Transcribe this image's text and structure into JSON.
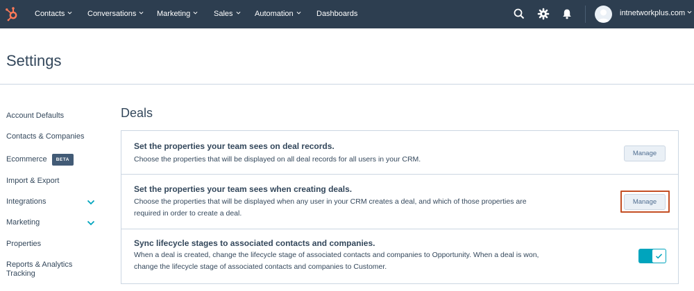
{
  "topnav": {
    "items": [
      {
        "label": "Contacts",
        "has_dropdown": true
      },
      {
        "label": "Conversations",
        "has_dropdown": true
      },
      {
        "label": "Marketing",
        "has_dropdown": true
      },
      {
        "label": "Sales",
        "has_dropdown": true
      },
      {
        "label": "Automation",
        "has_dropdown": true
      },
      {
        "label": "Dashboards",
        "has_dropdown": false
      }
    ],
    "icons": [
      "hubspot-logo-icon",
      "search-icon",
      "gear-icon",
      "bell-icon"
    ],
    "account": "intnetworkplus.com"
  },
  "page": {
    "title": "Settings"
  },
  "sidebar": {
    "items": [
      {
        "label": "Account Defaults"
      },
      {
        "label": "Contacts & Companies"
      },
      {
        "label": "Ecommerce",
        "badge": "BETA"
      },
      {
        "label": "Import & Export"
      },
      {
        "label": "Integrations",
        "expandable": true
      },
      {
        "label": "Marketing",
        "expandable": true
      },
      {
        "label": "Properties"
      },
      {
        "label": "Reports & Analytics Tracking"
      }
    ]
  },
  "main": {
    "section_title": "Deals",
    "cards": [
      {
        "title": "Set the properties your team sees on deal records.",
        "desc_lines": [
          "Choose the properties that will be displayed on all deal records for all users in your CRM."
        ],
        "action": "Manage"
      },
      {
        "title": "Set the properties your team sees when creating deals.",
        "desc_lines": [
          "Choose the properties that will be displayed when any user in your CRM creates a deal, and which of those properties are",
          "required in order to create a deal."
        ],
        "action": "Manage",
        "highlighted": true
      },
      {
        "title": "Sync lifecycle stages to associated contacts and companies.",
        "desc_lines": [
          "When a deal is created, change the lifecycle stage of associated contacts and companies to Opportunity. When a deal is won,",
          "change the lifecycle stage of associated contacts and companies to Customer."
        ],
        "toggle_on": true
      }
    ]
  },
  "colors": {
    "nav_bg": "#2d3e50",
    "brand_orange": "#ff7a59",
    "highlight": "#c44e23",
    "toggle_on": "#00a4bd",
    "sidebar_chevron": "#00a4bd"
  }
}
